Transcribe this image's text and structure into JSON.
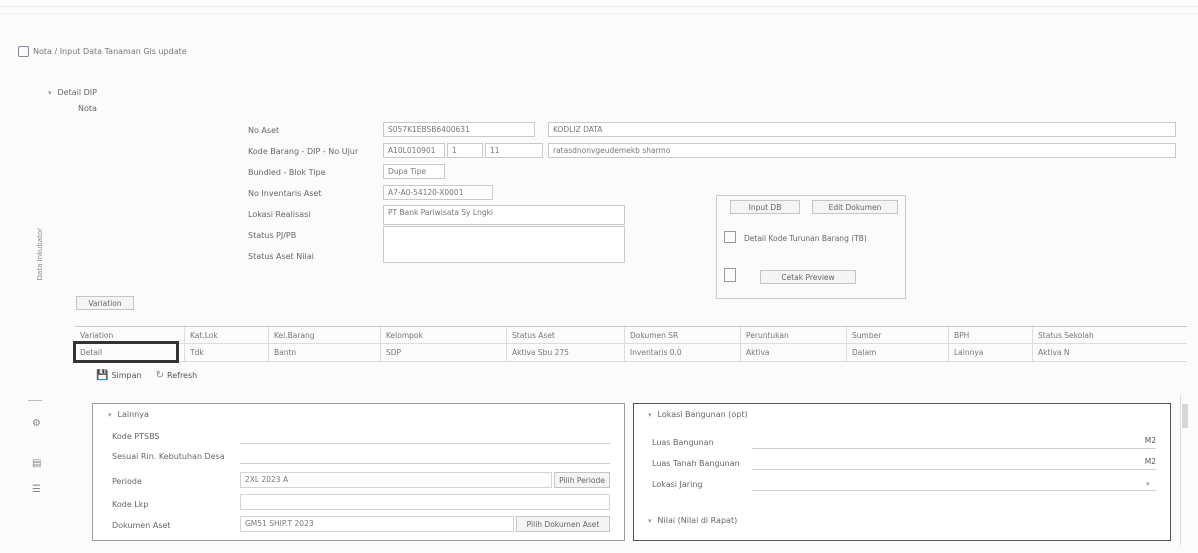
{
  "breadcrumb": {
    "text": "Nota / Input Data Tanaman Gis update"
  },
  "side_label": "Data Inkubator",
  "header": {
    "section_title": "Detail DIP",
    "sub_title": "Nota"
  },
  "form": {
    "fields": [
      {
        "label": "No Aset",
        "value": "S057K1EBSB6400631",
        "extra": "KODLIZ DATA"
      },
      {
        "label": "Kode Barang - DIP - No Ujur",
        "value": "A10L010901",
        "v2": "1",
        "v3": "11",
        "extra": "ratasdnonvgeudemekb sharmo"
      },
      {
        "label": "Bundled - Blok Tipe",
        "value": "Dupa Tipe"
      },
      {
        "label": "No Inventaris Aset",
        "value": "A7-A0-54120-X0001"
      },
      {
        "label": "Lokasi Realisasi",
        "value": "PT Bank Pariwisata Sy Lngki"
      },
      {
        "label": "Status PJ/PB",
        "value": ""
      },
      {
        "label": "Status Aset Nilai",
        "value": ""
      }
    ]
  },
  "actions": {
    "btn_a": "Input DB",
    "btn_b": "Edit Dokumen",
    "btn_c": "Detail Kode Turunan Barang (TB)",
    "btn_d": "Cetak Preview"
  },
  "toggle_button": "Variation",
  "grid": {
    "headers": [
      "Variation",
      "Kat.Lok",
      "Kel.Barang",
      "Kelompok",
      "Status Aset",
      "Dokumen SR",
      "Peruntukan",
      "Sumber",
      "BPH",
      "Status Sekolah"
    ],
    "row": [
      "Detail",
      "Tdk",
      "Bantn",
      "SDP",
      "Aktiva Sbu 275",
      "Inventaris 0.0",
      "Aktiva",
      "Dalam",
      "Lainnya",
      "Aktiva N"
    ]
  },
  "toolbar": {
    "save": "Simpan",
    "refresh": "Refresh"
  },
  "left_panel": {
    "title": "Lainnya",
    "fields": [
      {
        "label": "Kode PTSBS",
        "value": ""
      },
      {
        "label": "Sesuai Rin. Kebutuhan Desa",
        "value": ""
      },
      {
        "label": "Periode",
        "value": "2XL 2023 A",
        "btn": "Pilih Periode"
      },
      {
        "label": "Kode Lkp",
        "value": ""
      },
      {
        "label": "Dokumen Aset",
        "value": "GM51 SHIP.T 2023",
        "btn": "Pilih Dokumen Aset"
      }
    ]
  },
  "right_panel": {
    "title": "Lokasi Bangunan (opt)",
    "fields": [
      {
        "label": "Luas Bangunan",
        "value": "M2"
      },
      {
        "label": "Luas Tanah Bangunan",
        "value": "M2"
      },
      {
        "label": "Lokasi Jaring",
        "value": ""
      }
    ],
    "subtitle": "Nilai (Nilai di Rapat)"
  },
  "colors": {
    "highlight_border": "#333333",
    "panel_border": "#9c9c9c"
  }
}
